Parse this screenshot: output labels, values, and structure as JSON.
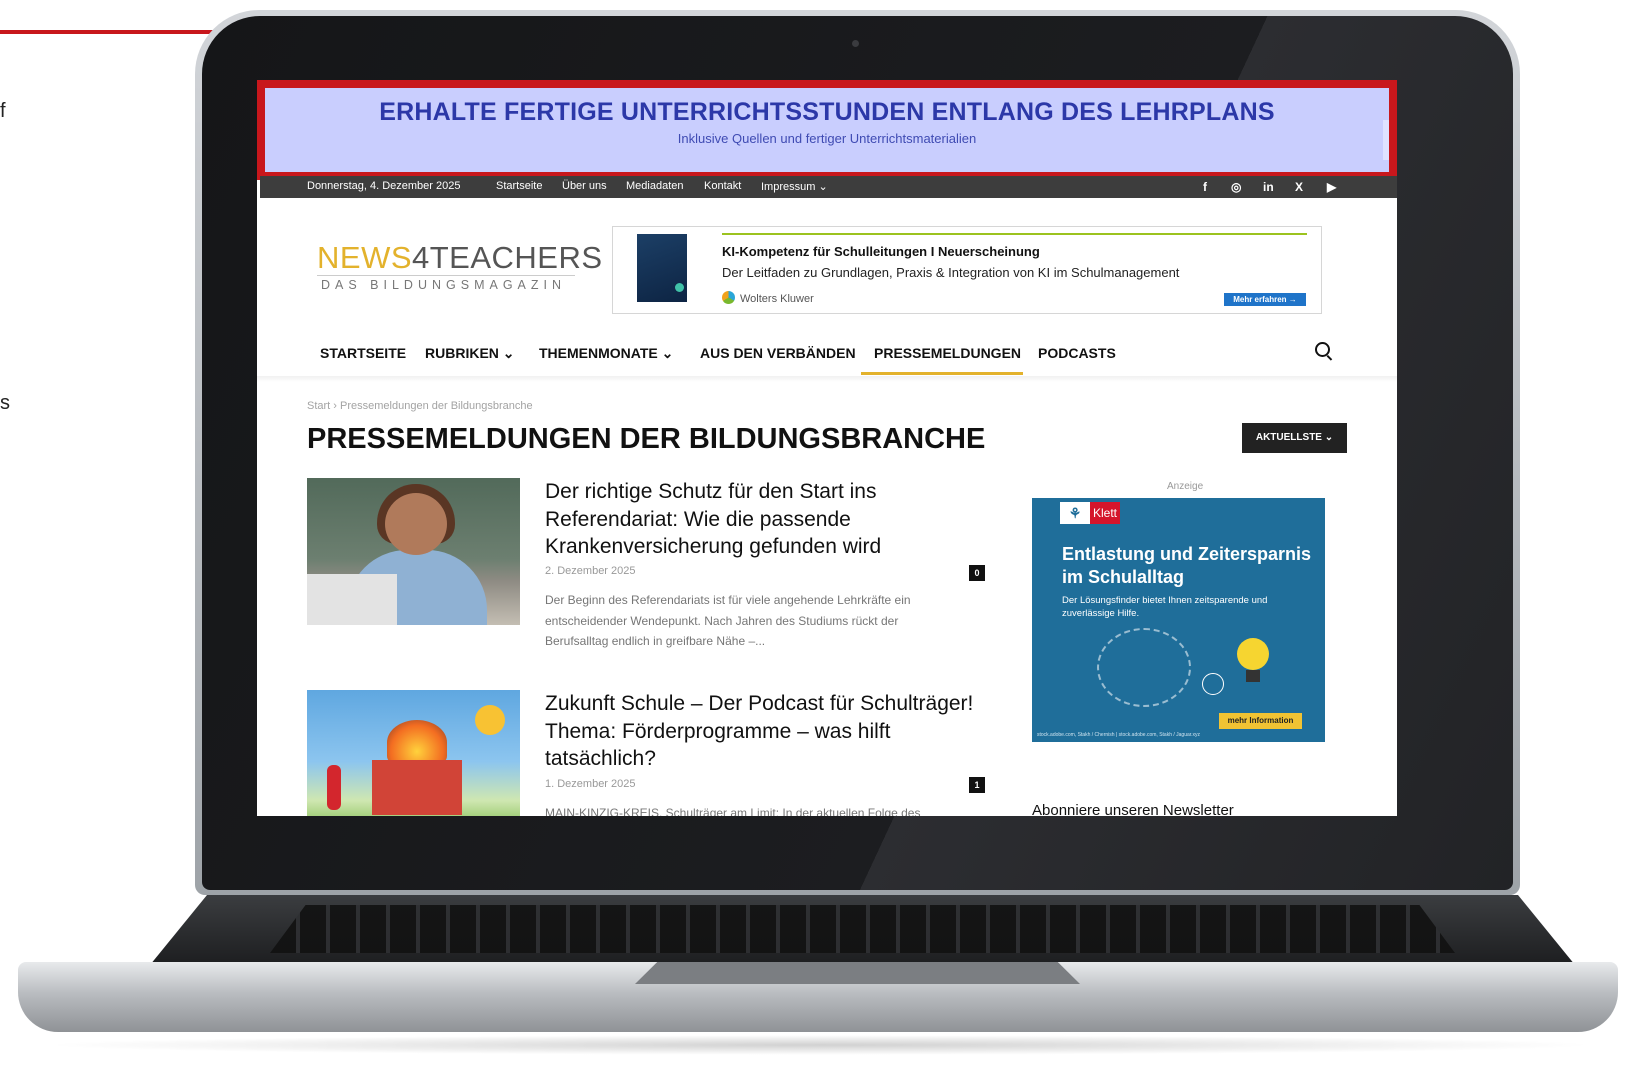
{
  "edge_fragments": {
    "a": "f",
    "b": "s"
  },
  "banner": {
    "title": "ERHALTE FERTIGE UNTERRICHTSSTUNDEN ENTLANG DES LEHRPLANS",
    "subtitle": "Inklusive Quellen und fertiger Unterrichtsmaterialien"
  },
  "topbar": {
    "date": "Donnerstag, 4. Dezember 2025",
    "links": [
      "Startseite",
      "Über uns",
      "Mediadaten",
      "Kontakt",
      "Impressum ⌄"
    ],
    "social": [
      "f",
      "◎",
      "in",
      "X",
      "▶"
    ]
  },
  "logo": {
    "part_a": "NEWS",
    "part_b": "4TEACHERS",
    "tagline": "DAS BILDUNGSMAGAZIN"
  },
  "header_ad": {
    "title": "KI-Kompetenz für Schulleitungen I Neuerscheinung",
    "subtitle": "Der Leitfaden zu Grundlagen, Praxis & Integration von KI im Schulmanagement",
    "brand": "Wolters Kluwer",
    "button": "Mehr erfahren →"
  },
  "nav": {
    "items": [
      "STARTSEITE",
      "RUBRIKEN ⌄",
      "THEMENMONATE ⌄",
      "AUS DEN VERBÄNDEN",
      "PRESSEMELDUNGEN",
      "PODCASTS"
    ],
    "active": "PRESSEMELDUNGEN"
  },
  "breadcrumb": {
    "home": "Start",
    "sep": "›",
    "current": "Pressemeldungen der Bildungsbranche"
  },
  "page": {
    "title": "PRESSEMELDUNGEN DER BILDUNGSBRANCHE",
    "sort_label": "AKTUELLSTE ⌄"
  },
  "articles": [
    {
      "title": "Der richtige Schutz für den Start ins Referendariat: Wie die passende Krankenversicherung gefunden wird",
      "date": "2. Dezember 2025",
      "comments": "0",
      "excerpt": "Der Beginn des Referendariats ist für viele angehende Lehrkräfte ein entscheidender Wendepunkt. Nach Jahren des Studiums rückt der Berufsalltag endlich in greifbare Nähe –..."
    },
    {
      "title": "Zukunft Schule – Der Podcast für Schulträger! Thema: Förderprogramme – was hilft tatsächlich?",
      "date": "1. Dezember 2025",
      "comments": "1",
      "excerpt": "MAIN-KINZIG-KREIS. Schulträger am Limit: In der aktuellen Folge des"
    }
  ],
  "sidebar": {
    "ad_label": "Anzeige",
    "ad": {
      "brand": "Klett",
      "title": "Entlastung und Zeitersparnis im Schulalltag",
      "text": "Der Lösungsfinder bietet Ihnen zeitsparende und zuverlässige Hilfe.",
      "button": "mehr Information",
      "credit": "stock.adobe.com, Stakh / Chernish | stock.adobe.com, Stakh / Jaguar.xyz"
    },
    "newsletter": "Abonniere unseren Newsletter"
  },
  "colors": {
    "accent": "#c8171c",
    "banner_bg": "#c9cefe",
    "banner_text": "#2c38a8",
    "nav_active": "#e3b22c",
    "klett_blue": "#1f6e9a"
  }
}
